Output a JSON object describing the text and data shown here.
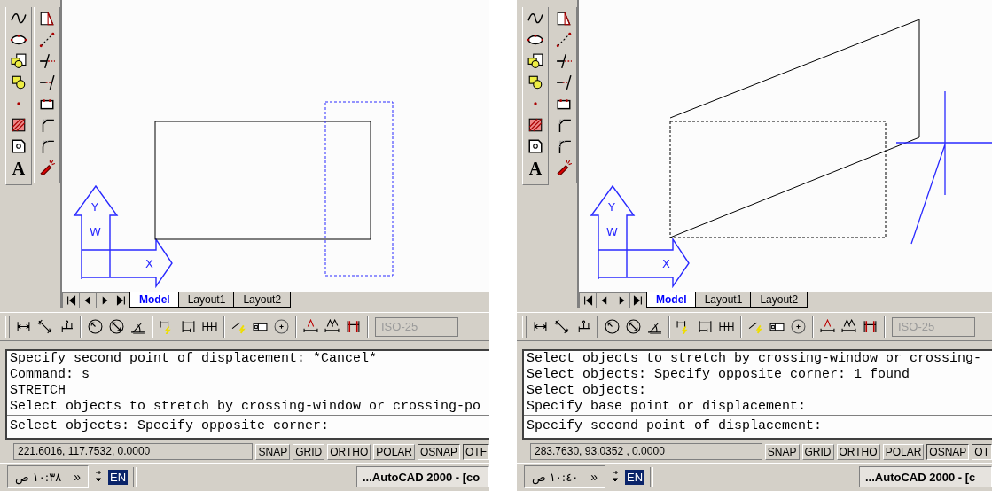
{
  "panels": [
    {
      "drawing": {
        "kind": "crossing-window"
      },
      "text_tool": "A",
      "ucs_icon": {
        "y_label": "Y",
        "w_label": "W",
        "x_label": "X"
      },
      "tabs": [
        {
          "label": "Model",
          "selected": true
        },
        {
          "label": "Layout1",
          "selected": false
        },
        {
          "label": "Layout2",
          "selected": false
        }
      ],
      "dim_style": {
        "value": "ISO-25",
        "disabled": true
      },
      "command_history": [
        "Specify second point of displacement: *Cancel*",
        "Command: s",
        "STRETCH",
        "Select objects to stretch by crossing-window or crossing-po"
      ],
      "command_prompt": "Select objects: Specify opposite corner:",
      "status_bar": {
        "coordinates": "221.6016, 117.7532, 0.0000",
        "toggles": [
          {
            "label": "SNAP",
            "on": false
          },
          {
            "label": "GRID",
            "on": false
          },
          {
            "label": "ORTHO",
            "on": false
          },
          {
            "label": "POLAR",
            "on": false
          },
          {
            "label": "OSNAP",
            "on": true
          },
          {
            "label": "OTF",
            "on": true
          }
        ]
      },
      "taskbar": {
        "clock": "١٠:٣٨ ص",
        "chevron": "»",
        "language": "EN",
        "task": "...AutoCAD 2000 - [co"
      }
    },
    {
      "drawing": {
        "kind": "stretch-preview"
      },
      "text_tool": "A",
      "ucs_icon": {
        "y_label": "Y",
        "w_label": "W",
        "x_label": "X"
      },
      "tabs": [
        {
          "label": "Model",
          "selected": true
        },
        {
          "label": "Layout1",
          "selected": false
        },
        {
          "label": "Layout2",
          "selected": false
        }
      ],
      "dim_style": {
        "value": "ISO-25",
        "disabled": true
      },
      "command_history": [
        "Select objects to stretch by crossing-window or crossing-",
        "Select objects: Specify opposite corner: 1 found",
        "Select objects:",
        "Specify base point or displacement:"
      ],
      "command_prompt": "Specify second point of displacement:",
      "status_bar": {
        "coordinates": "283.7630, 93.0352 , 0.0000",
        "toggles": [
          {
            "label": "SNAP",
            "on": false
          },
          {
            "label": "GRID",
            "on": false
          },
          {
            "label": "ORTHO",
            "on": false
          },
          {
            "label": "POLAR",
            "on": false
          },
          {
            "label": "OSNAP",
            "on": true
          },
          {
            "label": "OT",
            "on": true
          }
        ]
      },
      "taskbar": {
        "clock": "١٠:٤٠ ص",
        "chevron": "»",
        "language": "EN",
        "task": "...AutoCAD 2000 - [c"
      }
    }
  ]
}
